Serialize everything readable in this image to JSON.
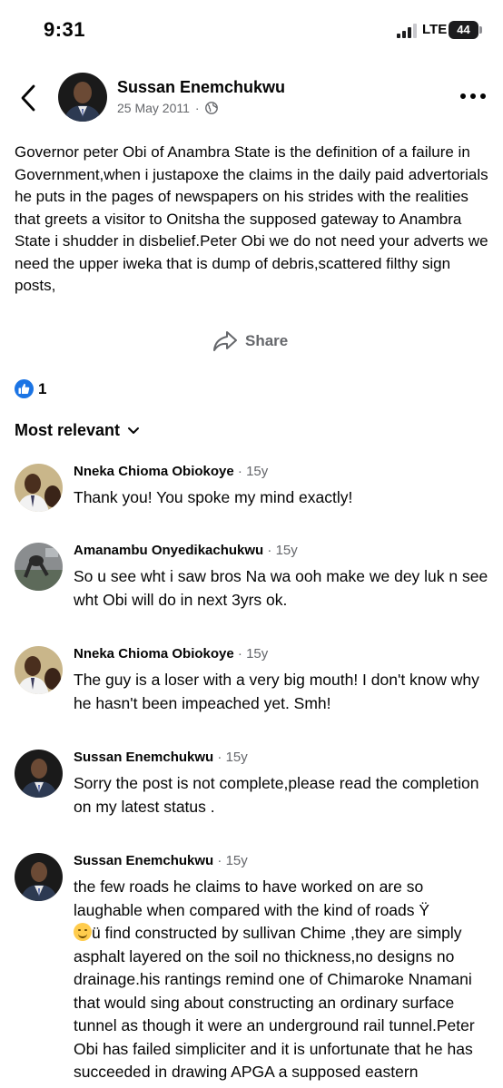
{
  "status_bar": {
    "time": "9:31",
    "network": "LTE",
    "battery": "44"
  },
  "post": {
    "author": "Sussan Enemchukwu",
    "date": "25 May 2011",
    "meta_separator": "·",
    "privacy_icon": "globe-icon",
    "text": "Governor peter Obi of Anambra State is the definition of a failure in Government,when i  justapoxe the claims in the daily paid advertorials he puts in the pages of newspapers on his strides with the realities that greets a visitor to Onitsha the supposed gateway to Anambra State i shudder in disbelief.Peter Obi we do not need your adverts we need the upper iweka that is dump of debris,scattered filthy sign posts,",
    "share_label": "Share",
    "reaction_count": "1"
  },
  "comments_section": {
    "sort_label": "Most relevant",
    "comments": [
      {
        "name": "Nneka Chioma Obiokoye",
        "separator": "·",
        "time": "15y",
        "text": "Thank you! You spoke my mind exactly!"
      },
      {
        "name": "Amanambu Onyedikachukwu",
        "separator": "·",
        "time": "15y",
        "text": "So u see wht i saw bros Na wa ooh make we dey luk n see wht Obi will do in next 3yrs ok."
      },
      {
        "name": "Nneka Chioma Obiokoye",
        "separator": "·",
        "time": "15y",
        "text": "The guy is a loser with a very big mouth! I don't know why he hasn't been impeached yet. Smh!"
      },
      {
        "name": "Sussan Enemchukwu",
        "separator": "·",
        "time": "15y",
        "text": "Sorry the  post is not complete,please read the completion on my latest status ."
      },
      {
        "name": "Sussan Enemchukwu",
        "separator": "·",
        "time": "15y",
        "text_part1": "the few roads he claims to have worked on are so laughable when compared with the kind of roads Ÿ",
        "text_part2": "ü find constructed by sullivan Chime ,they are simply asphalt layered on the soil no thickness,no designs no drainage.his rantings remind one of Chimaroke Nnamani that would sing about constructing an ordinary surface tunnel as though it were an underground rail tunnel.Peter Obi has failed simpliciter and it is unfortunate that he has succeeded in drawing APGA a supposed eastern"
      }
    ]
  },
  "colors": {
    "text": "#050505",
    "secondary": "#65676b",
    "like_blue": "#1b74e4"
  }
}
